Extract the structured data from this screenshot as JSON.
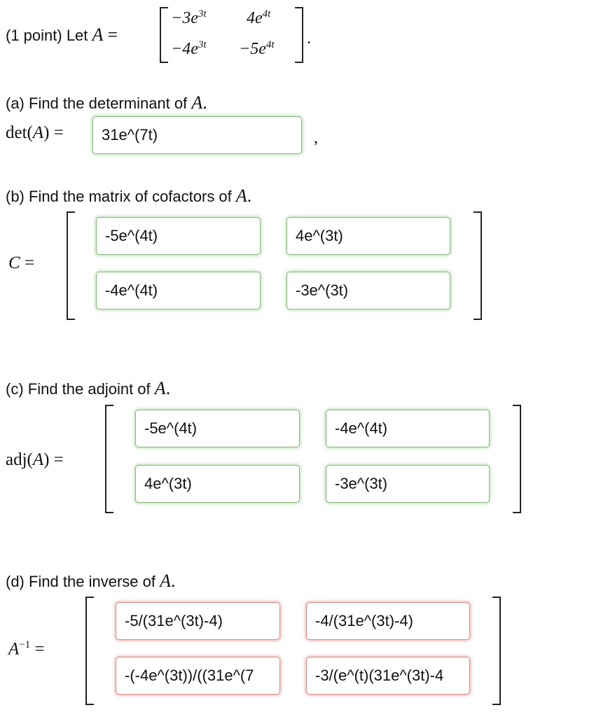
{
  "header": {
    "points": "(1 point) Let",
    "var": "A",
    "eq": "=",
    "matrix": [
      [
        "−3e",
        "3t",
        "4e",
        "4t"
      ],
      [
        "−4e",
        "3t",
        "−5e",
        "4t"
      ]
    ],
    "period": "."
  },
  "part_a": {
    "question": "(a) Find the determinant of",
    "var": "A",
    "lhs_prefix": "det(",
    "lhs_var": "A",
    "lhs_suffix": ") =",
    "answer": "31e^(7t)",
    "trailing": ","
  },
  "part_b": {
    "question": "(b) Find the matrix of cofactors of",
    "var": "A",
    "lhs_var": "C",
    "lhs_eq": "=",
    "answers": [
      [
        "-5e^(4t)",
        "4e^(3t)"
      ],
      [
        "-4e^(4t)",
        "-3e^(3t)"
      ]
    ]
  },
  "part_c": {
    "question": "(c) Find the adjoint of",
    "var": "A",
    "lhs_prefix": "adj(",
    "lhs_var": "A",
    "lhs_suffix": ") =",
    "answers": [
      [
        "-5e^(4t)",
        "-4e^(4t)"
      ],
      [
        "4e^(3t)",
        "-3e^(3t)"
      ]
    ]
  },
  "part_d": {
    "question": "(d) Find the inverse of",
    "var": "A",
    "lhs_var": "A",
    "lhs_sup": "−1",
    "lhs_eq": "=",
    "answers": [
      [
        "-5/(31e^(3t)-4)",
        "-4/(31e^(3t)-4)"
      ],
      [
        "-(-4e^(3t))/((31e^(7",
        "-3/(e^(t)(31e^(3t)-4"
      ]
    ]
  },
  "colors": {
    "correct_border": "#87b87d",
    "incorrect_border": "#d58c8c"
  }
}
